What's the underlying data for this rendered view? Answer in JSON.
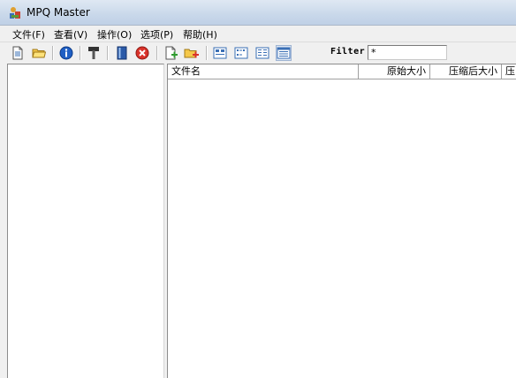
{
  "window": {
    "title": "MPQ Master",
    "app_icon": "mpq-master-app-icon"
  },
  "menu": [
    {
      "label": "文件(F)"
    },
    {
      "label": "查看(V)"
    },
    {
      "label": "操作(O)"
    },
    {
      "label": "选项(P)"
    },
    {
      "label": "帮助(H)"
    }
  ],
  "toolbar": {
    "buttons": [
      {
        "icon": "new-document-icon"
      },
      {
        "icon": "open-folder-icon"
      },
      {
        "icon": "info-icon"
      },
      {
        "icon": "hammer-tool-icon"
      },
      {
        "icon": "book-icon"
      },
      {
        "icon": "close-red-icon"
      },
      {
        "icon": "add-file-icon"
      },
      {
        "icon": "add-folder-icon"
      },
      {
        "icon": "large-icons-view-icon"
      },
      {
        "icon": "small-icons-view-icon"
      },
      {
        "icon": "list-view-icon"
      },
      {
        "icon": "details-view-icon"
      }
    ],
    "filter_label": "Filter",
    "filter_value": "*"
  },
  "file_list": {
    "columns": [
      "文件名",
      "原始大小",
      "压缩后大小",
      "压"
    ],
    "rows": []
  }
}
